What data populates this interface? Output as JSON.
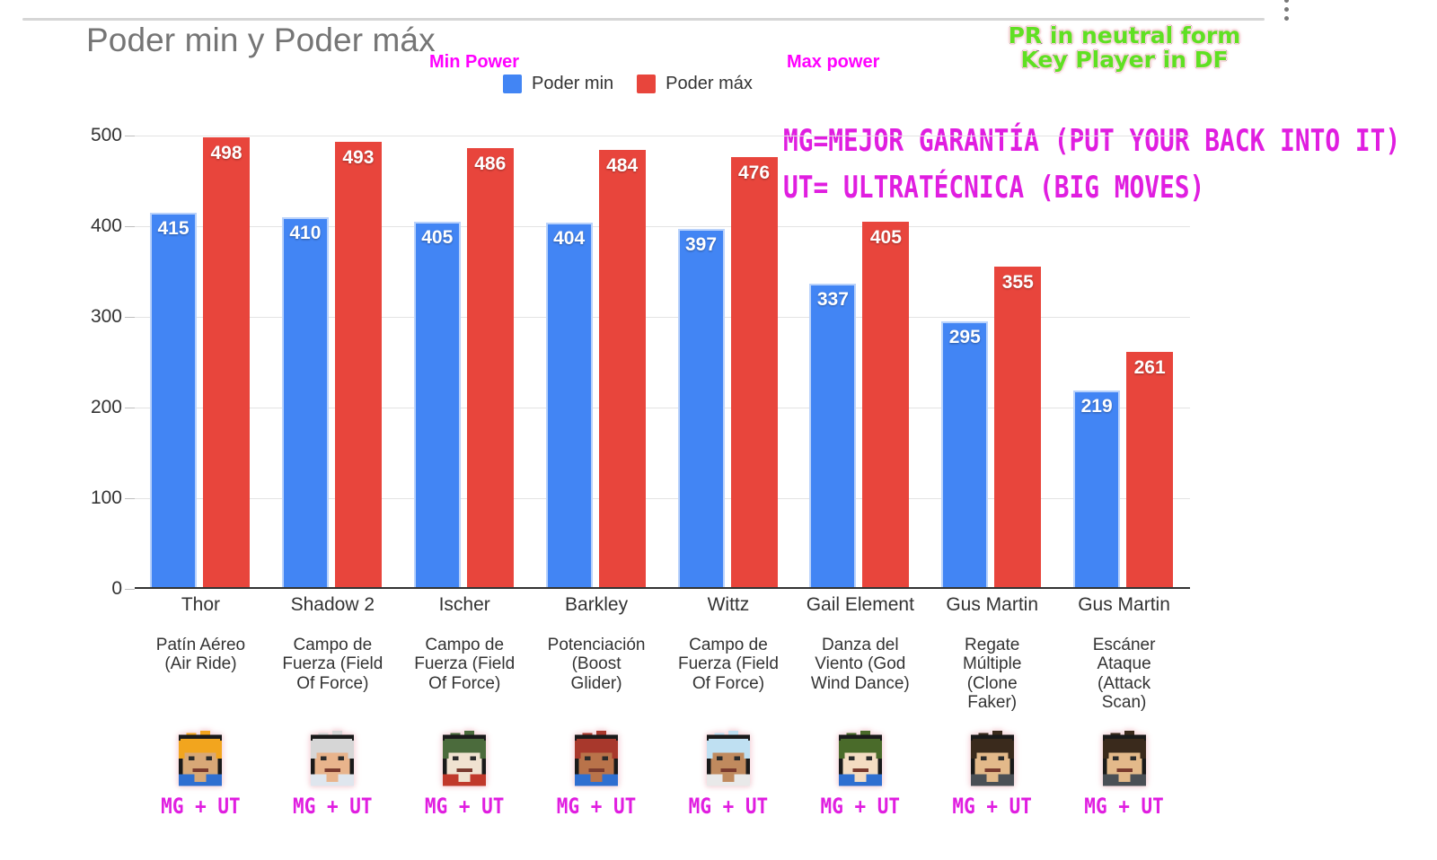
{
  "header": {
    "title": "Poder min y Poder máx",
    "menu_icon": "kebab-menu-icon"
  },
  "annotations": {
    "min_power": "Min Power",
    "max_power": "Max power",
    "badge_line1": "PR in neutral form",
    "badge_line2": "Key Player in DF",
    "note_mg": "MG=MEJOR GARANTÍA (PUT YOUR BACK INTO IT)",
    "note_ut": "UT= ULTRATÉCNICA (BIG MOVES)",
    "badge_color": "#5fe022",
    "note_color": "#e01ee0",
    "plain_color": "#ff00ff"
  },
  "legend": {
    "items": [
      {
        "label": "Poder min",
        "color": "#4285f4"
      },
      {
        "label": "Poder máx",
        "color": "#e8453c"
      }
    ]
  },
  "chart_data": {
    "type": "bar",
    "title": "Poder min y Poder máx",
    "xlabel": "",
    "ylabel": "",
    "ylim": [
      0,
      500
    ],
    "yticks": [
      0,
      100,
      200,
      300,
      400,
      500
    ],
    "grid": true,
    "legend_position": "top-center",
    "categories": [
      "Thor",
      "Shadow 2",
      "Ischer",
      "Barkley",
      "Wittz",
      "Gail Element",
      "Gus Martin",
      "Gus Martin"
    ],
    "subcategories": [
      "Patín Aéreo (Air Ride)",
      "Campo de Fuerza (Field Of Force)",
      "Campo de Fuerza (Field Of Force)",
      "Potenciación (Boost Glider)",
      "Campo de Fuerza (Field Of Force)",
      "Danza del Viento (God Wind Dance)",
      "Regate Múltiple (Clone Faker)",
      "Escáner Ataque (Attack Scan)"
    ],
    "series": [
      {
        "name": "Poder min",
        "color": "#4285f4",
        "values": [
          415,
          410,
          405,
          404,
          397,
          337,
          295,
          219
        ]
      },
      {
        "name": "Poder máx",
        "color": "#e8453c",
        "values": [
          498,
          493,
          486,
          484,
          476,
          405,
          355,
          261
        ]
      }
    ]
  },
  "categories_display": [
    {
      "name": "Thor",
      "move_lines": [
        "Patín Aéreo",
        "(Air Ride)"
      ]
    },
    {
      "name": "Shadow 2",
      "move_lines": [
        "Campo de",
        "Fuerza (Field",
        "Of Force)"
      ]
    },
    {
      "name": "Ischer",
      "move_lines": [
        "Campo de",
        "Fuerza (Field",
        "Of Force)"
      ]
    },
    {
      "name": "Barkley",
      "move_lines": [
        "Potenciación",
        "(Boost",
        "Glider)"
      ]
    },
    {
      "name": "Wittz",
      "move_lines": [
        "Campo de",
        "Fuerza (Field",
        "Of Force)"
      ]
    },
    {
      "name": "Gail Element",
      "move_lines": [
        "Danza del",
        "Viento (God",
        "Wind Dance)"
      ]
    },
    {
      "name": "Gus Martin",
      "move_lines": [
        "Regate",
        "Múltiple",
        "(Clone",
        "Faker)"
      ]
    },
    {
      "name": "Gus Martin",
      "move_lines": [
        "Escáner",
        "Ataque",
        "(Attack",
        "Scan)"
      ]
    }
  ],
  "sprites": [
    {
      "character": "Thor",
      "hair": "#f2a51e",
      "skin": "#d8a877",
      "body": "#2f6fd0",
      "tag": "MG + UT"
    },
    {
      "character": "Shadow 2",
      "hair": "#d6d6d6",
      "skin": "#e8b48c",
      "body": "#dfe6ee",
      "tag": "MG + UT"
    },
    {
      "character": "Ischer",
      "hair": "#4b6b3c",
      "skin": "#f0e2d0",
      "body": "#c0392b",
      "tag": "MG + UT"
    },
    {
      "character": "Barkley",
      "hair": "#a8382c",
      "skin": "#b9734a",
      "body": "#2f6fd0",
      "tag": "MG + UT"
    },
    {
      "character": "Wittz",
      "hair": "#bfe0f2",
      "skin": "#c08a5e",
      "body": "#e9e9e9",
      "tag": "MG + UT"
    },
    {
      "character": "Gail Element",
      "hair": "#4a6b2a",
      "skin": "#f4dcc2",
      "body": "#2f6fd0",
      "tag": "MG + UT"
    },
    {
      "character": "Gus Martin",
      "hair": "#3a2a1c",
      "skin": "#e3b98a",
      "body": "#4a4f55",
      "tag": "MG + UT"
    },
    {
      "character": "Gus Martin",
      "hair": "#3a2a1c",
      "skin": "#e3b98a",
      "body": "#4a4f55",
      "tag": "MG + UT"
    }
  ]
}
